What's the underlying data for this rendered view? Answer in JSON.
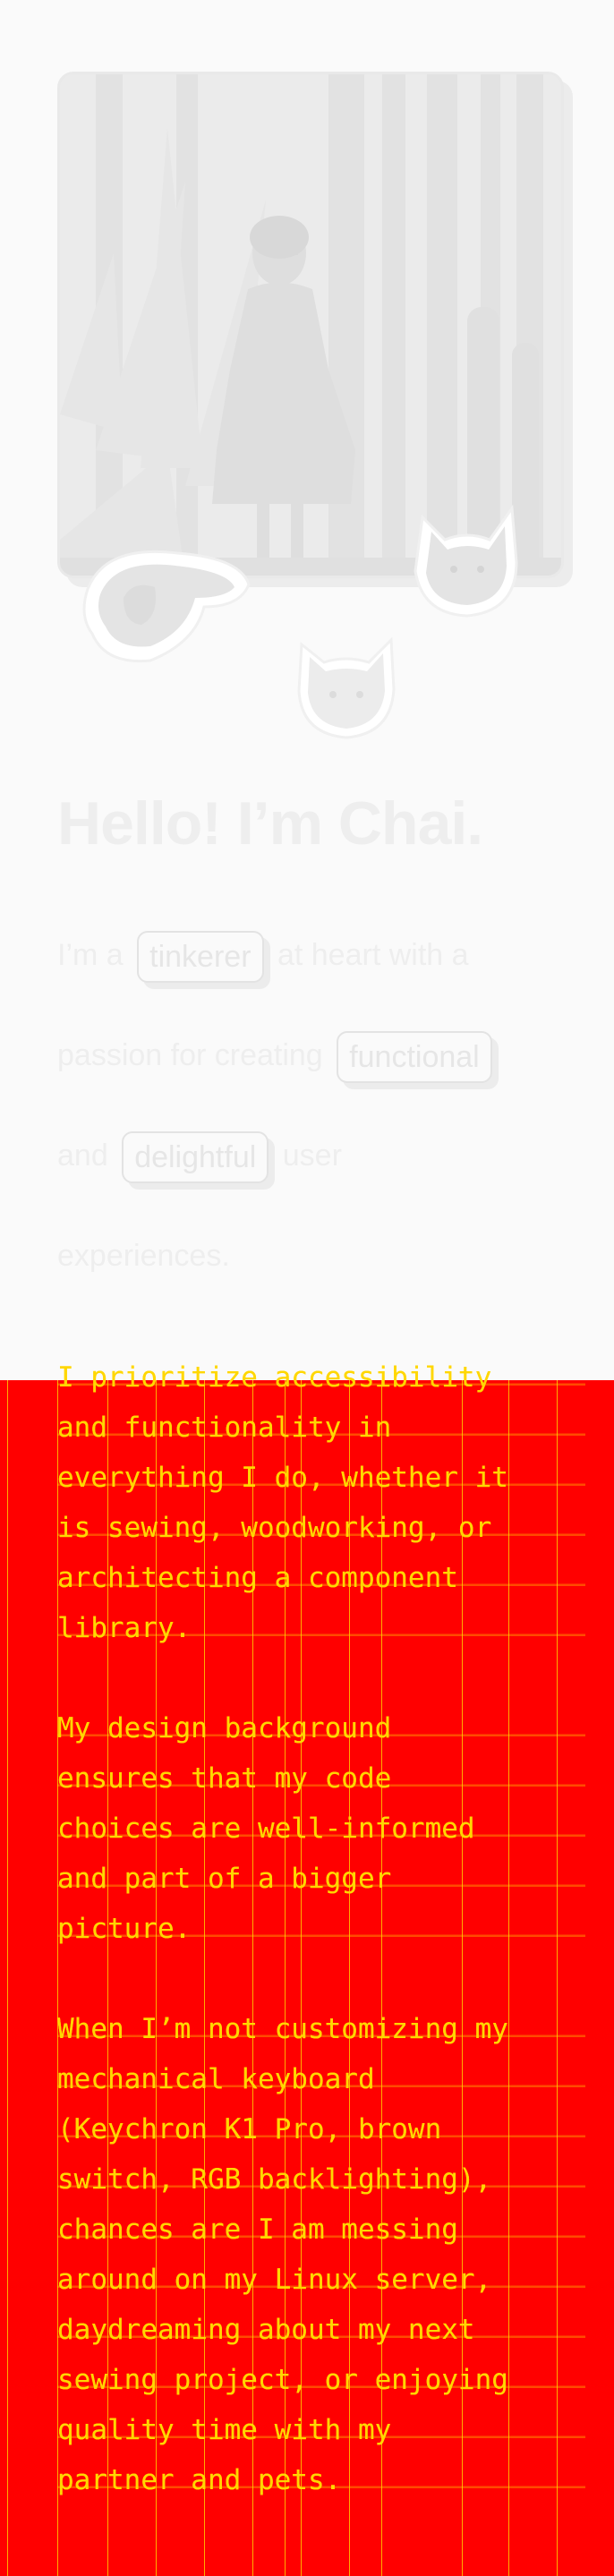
{
  "intro": {
    "title": "Hello! I’m Chai.",
    "line1_prefix": "I’m a",
    "pill1": "tinkerer",
    "line1_suffix": "at heart with a",
    "line2_prefix": "passion for creating",
    "pill2": "functional",
    "line3_prefix": "and",
    "pill3": "delightful",
    "line3_suffix": "user",
    "line4": "experiences."
  },
  "bio": {
    "paragraph1": [
      "I prioritize accessibility",
      "and functionality in",
      "everything I do, whether it",
      "is sewing, woodworking, or",
      "architecting a component",
      "library."
    ],
    "paragraph2": [
      "My design background",
      "ensures that my code",
      "choices are well-informed",
      "and part of a bigger",
      "picture."
    ],
    "paragraph3": [
      "When I’m not customizing my",
      "mechanical keyboard",
      "(Keychron K1 Pro, brown",
      "switch, RGB backlighting),",
      "chances are I am messing",
      "around on my Linux server,",
      "daydreaming about my next",
      "sewing project, or enjoying",
      "quality time with my",
      "partner and pets."
    ]
  },
  "colors": {
    "background": "#fafafa",
    "faded_text": "#eeeeee",
    "code_section": "#ff0000",
    "code_text": "#ffd700"
  },
  "images": {
    "portrait": "portrait-photo",
    "pets": [
      "dog-sticker",
      "cat-sticker-gray",
      "cat-sticker-white"
    ]
  }
}
